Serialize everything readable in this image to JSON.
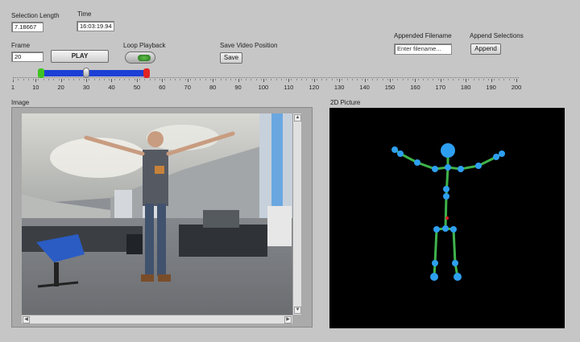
{
  "controls": {
    "selection_length": {
      "label": "Selection Length",
      "value": "7.18667"
    },
    "time": {
      "label": "Time",
      "value": "16:03:19.94"
    },
    "frame": {
      "label": "Frame",
      "value": "20"
    },
    "play_label": "PLAY",
    "loop_playback_label": "Loop Playback",
    "save_video_position": {
      "label": "Save Video Position",
      "button": "Save"
    },
    "appended_filename": {
      "label": "Appended Filename",
      "placeholder": "Enter filename..."
    },
    "append_selections": {
      "label": "Append Selections",
      "button": "Append"
    }
  },
  "timeline": {
    "ticks": [
      "1",
      "10",
      "20",
      "30",
      "40",
      "50",
      "60",
      "70",
      "80",
      "90",
      "100",
      "110",
      "120",
      "130",
      "140",
      "150",
      "160",
      "170",
      "180",
      "190",
      "200"
    ],
    "min": 1,
    "max": 200,
    "selection_start": 12,
    "selection_end": 54,
    "current": 30,
    "colors": {
      "selection": "#1c3fd6",
      "start_marker": "#3ec321",
      "end_marker": "#e02424"
    }
  },
  "image_panel": {
    "label": "Image"
  },
  "picture_panel": {
    "label": "2D Picture",
    "colors": {
      "joint": "#2e9ff0",
      "bone": "#3fb34b",
      "center": "#e02020",
      "background": "#000000"
    }
  }
}
